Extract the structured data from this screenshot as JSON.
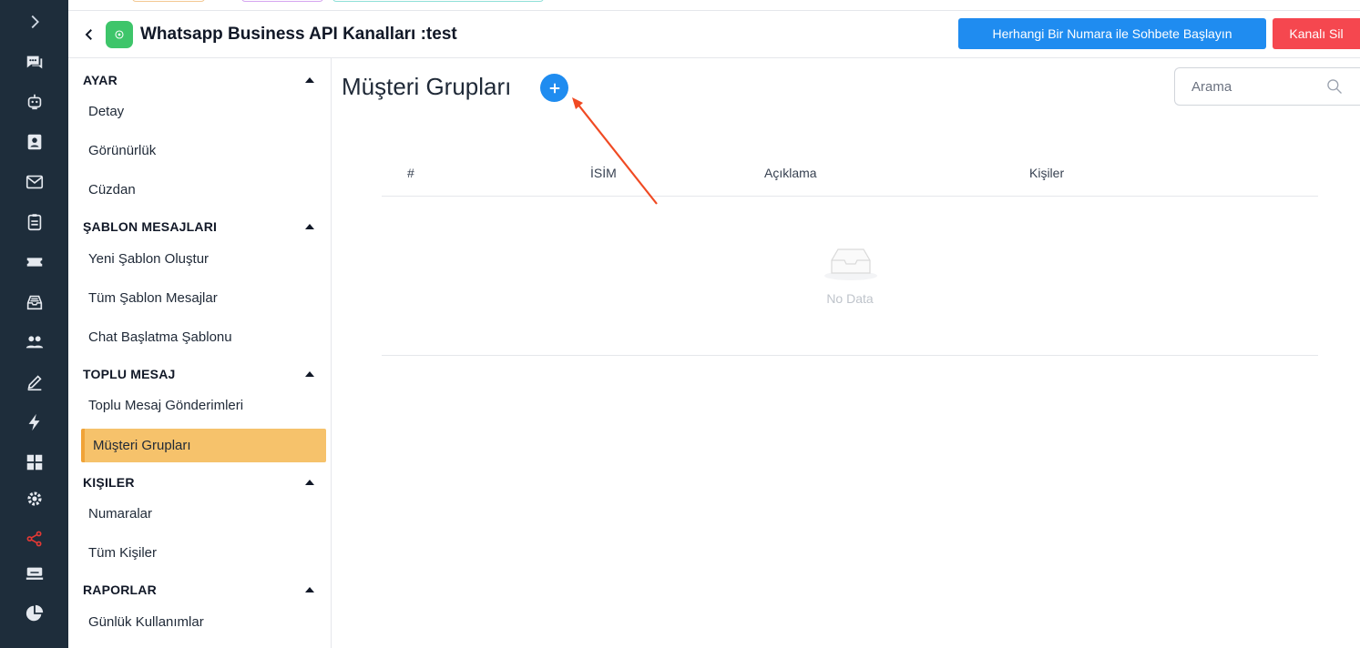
{
  "rail": {
    "items": [
      {
        "icon": "chevron-right-icon"
      },
      {
        "icon": "chat-bubbles-icon"
      },
      {
        "icon": "robot-icon"
      },
      {
        "icon": "contact-card-icon"
      },
      {
        "icon": "mail-icon"
      },
      {
        "icon": "clipboard-icon"
      },
      {
        "icon": "ticket-icon"
      },
      {
        "icon": "inbox-tray-icon"
      },
      {
        "icon": "users-icon"
      },
      {
        "icon": "pen-icon"
      },
      {
        "icon": "lightning-icon"
      },
      {
        "icon": "grid-icon"
      },
      {
        "icon": "gear-icon"
      },
      {
        "icon": "share-nodes-icon",
        "active": true
      },
      {
        "icon": "keyboard-icon"
      },
      {
        "icon": "pie-chart-icon"
      }
    ],
    "active_color": "#e53935"
  },
  "header": {
    "title": "Whatsapp Business API Kanalları :test",
    "start_chat_label": "Herhangi Bir Numara ile Sohbete Başlayın",
    "delete_channel_label": "Kanalı Sil"
  },
  "menu": {
    "sections": [
      {
        "label": "AYAR",
        "items": [
          "Detay",
          "Görünürlük",
          "Cüzdan"
        ]
      },
      {
        "label": "ŞABLON MESAJLARI",
        "items": [
          "Yeni Şablon Oluştur",
          "Tüm Şablon Mesajlar",
          "Chat Başlatma Şablonu"
        ]
      },
      {
        "label": "TOPLU MESAJ",
        "items": [
          "Toplu Mesaj Gönderimleri",
          "Müşteri Grupları"
        ]
      },
      {
        "label": "KIŞILER",
        "items": [
          "Numaralar",
          "Tüm Kişiler"
        ]
      },
      {
        "label": "RAPORLAR",
        "items": [
          "Günlük Kullanımlar"
        ]
      }
    ],
    "active_item": "Müşteri Grupları"
  },
  "main": {
    "title": "Müşteri Grupları",
    "search_placeholder": "Arama",
    "columns": [
      "#",
      "İSİM",
      "Açıklama",
      "Kişiler"
    ],
    "empty_text": "No Data"
  },
  "colors": {
    "primary": "#1f8cf0",
    "danger": "#f5474f",
    "active_menu": "#f6c26b",
    "annotation_arrow": "#f04a23"
  }
}
